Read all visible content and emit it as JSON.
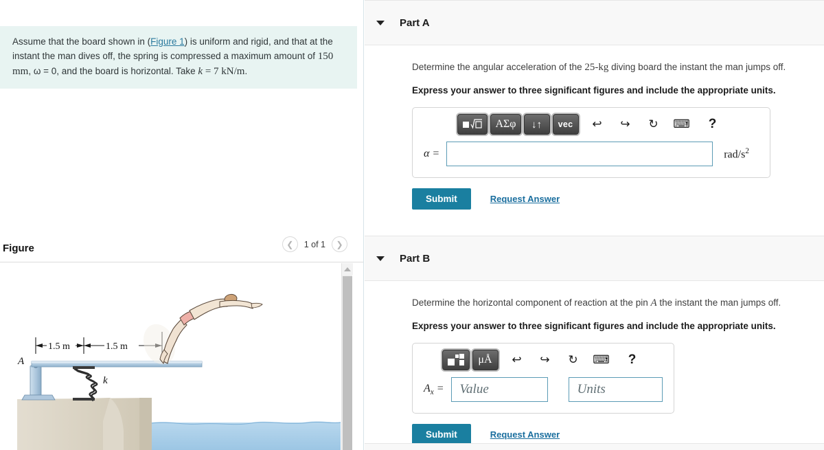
{
  "problem": {
    "text_a": "Assume that the board shown in (",
    "figure_link": "Figure 1",
    "text_b": ") is uniform and rigid, and that at the instant the man dives off, the spring is compressed a maximum amount of ",
    "value_150mm": "150 mm",
    "text_c": ", ω = 0, and the board is horizontal. Take ",
    "k_label": "k",
    "k_value": " = 7 kN/m",
    "text_d": "."
  },
  "figure": {
    "title": "Figure",
    "counter": "1 of 1",
    "prev_icon": "chevron-left-icon",
    "next_icon": "chevron-right-icon",
    "diagram": {
      "dim_left": "1.5 m",
      "dim_right": "1.5 m",
      "pin_label": "A",
      "spring_label": "k"
    }
  },
  "parts": [
    {
      "id": "a",
      "title": "Part A",
      "question": "Determine the angular acceleration of the 25-kg diving board the instant the man jumps off.",
      "question_plain_a": "Determine the angular acceleration of the ",
      "question_mass": "25-kg",
      "question_plain_b": " diving board the instant the man jumps off.",
      "instruction": "Express your answer to three significant figures and include the appropriate units.",
      "toolbar": {
        "template_icon": "math-template-icon",
        "greek_label": "ΑΣφ",
        "arrows_label": "↓↑",
        "vec_label": "vec",
        "undo_icon": "undo-icon",
        "redo_icon": "redo-icon",
        "reset_icon": "reset-icon",
        "keyboard_icon": "keyboard-icon",
        "help_icon": "help-icon"
      },
      "field_label": "α =",
      "field_value": "",
      "field_placeholder": "",
      "unit_text": "rad/s",
      "unit_exp": "2",
      "submit_label": "Submit",
      "request_label": "Request Answer"
    },
    {
      "id": "b",
      "title": "Part B",
      "question_plain_a": "Determine the horizontal component of reaction at the pin ",
      "question_symbol": "A",
      "question_plain_b": " the instant the man jumps off.",
      "instruction": "Express your answer to three significant figures and include the appropriate units.",
      "toolbar": {
        "template_icon": "value-units-template-icon",
        "units_label": "μÅ",
        "undo_icon": "undo-icon",
        "redo_icon": "redo-icon",
        "reset_icon": "reset-icon",
        "keyboard_icon": "keyboard-icon",
        "help_icon": "help-icon"
      },
      "field_label_base": "A",
      "field_label_sub": "x",
      "field_label_eq": " =",
      "value_placeholder": "Value",
      "units_placeholder": "Units",
      "submit_label": "Submit",
      "request_label": "Request Answer"
    }
  ],
  "colors": {
    "accent": "#1a7fa0",
    "link": "#1a6e9e",
    "problem_bg": "#e8f4f2",
    "header_bg": "#f8f8f8",
    "board_blue": "#b8cfe3",
    "water_blue": "#a9cde8",
    "ground_tan": "#d9d3c3"
  }
}
